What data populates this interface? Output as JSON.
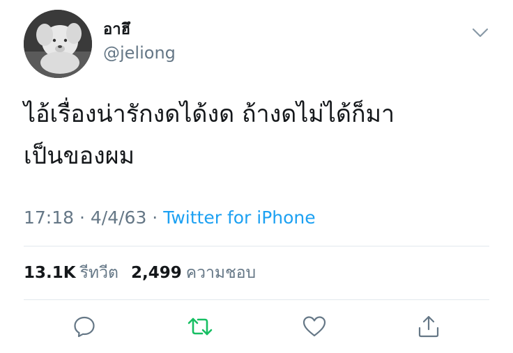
{
  "author": {
    "display_name": "อาฮึ",
    "handle": "@jeliong"
  },
  "tweet": {
    "line1": "ไอ้เรื่องน่ารักงดได้งด ถ้างดไม่ได้ก็มา",
    "line2": "เป็นของผม"
  },
  "meta": {
    "time": "17:18",
    "sep1": " · ",
    "date": "4/4/63",
    "sep2": " · ",
    "source": "Twitter for iPhone"
  },
  "stats": {
    "retweets": {
      "count": "13.1K",
      "label": "รีทวีต"
    },
    "likes": {
      "count": "2,499",
      "label": "ความชอบ"
    }
  },
  "actions": {
    "reply_icon": "reply-icon",
    "retweet_icon": "retweet-icon",
    "like_icon": "heart-icon",
    "share_icon": "share-icon"
  },
  "colors": {
    "text": "#14171a",
    "secondary": "#657786",
    "link": "#1da1f2",
    "retweet": "#17bf63",
    "divider": "#e1e8ed"
  }
}
